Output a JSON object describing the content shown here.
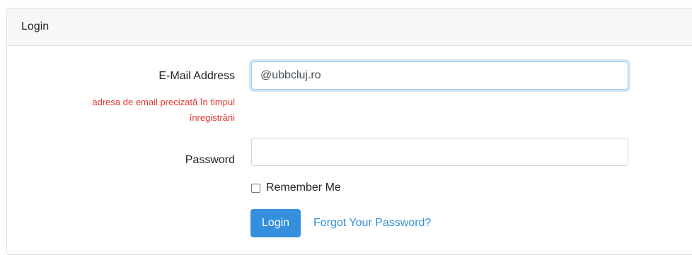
{
  "card": {
    "header_title": "Login"
  },
  "form": {
    "email_label": "E-Mail Address",
    "email_hint": "adresa de email precizată în timpul înregistrării",
    "email_value": "@ubbcluj.ro",
    "password_label": "Password",
    "password_value": "",
    "remember_label": "Remember Me",
    "remember_checked": false,
    "login_button": "Login",
    "forgot_link": "Forgot Your Password?"
  },
  "colors": {
    "primary": "#3490dc",
    "hint_red": "#e3342f",
    "header_bg": "#f7f7f7"
  }
}
